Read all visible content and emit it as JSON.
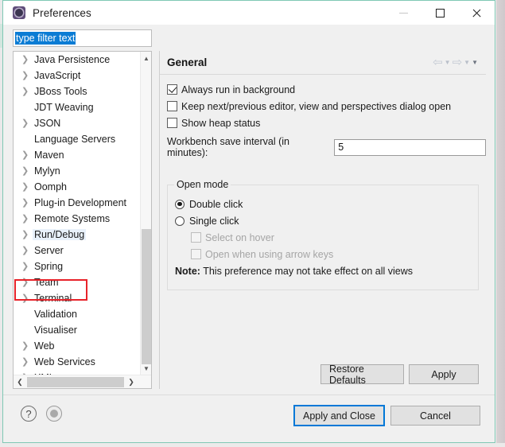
{
  "window": {
    "title": "Preferences",
    "icon": "preferences-gear-icon",
    "controls": {
      "minimize": "minimize-icon",
      "maximize": "maximize-icon",
      "close": "close-icon"
    }
  },
  "filter": {
    "value": "type filter text",
    "placeholder": "type filter text",
    "selected": true
  },
  "tree": {
    "items": [
      {
        "label": "Java Persistence",
        "expandable": true,
        "selected": false
      },
      {
        "label": "JavaScript",
        "expandable": true,
        "selected": false
      },
      {
        "label": "JBoss Tools",
        "expandable": true,
        "selected": false
      },
      {
        "label": "JDT Weaving",
        "expandable": false,
        "selected": false
      },
      {
        "label": "JSON",
        "expandable": true,
        "selected": false
      },
      {
        "label": "Language Servers",
        "expandable": false,
        "selected": false
      },
      {
        "label": "Maven",
        "expandable": true,
        "selected": false
      },
      {
        "label": "Mylyn",
        "expandable": true,
        "selected": false
      },
      {
        "label": "Oomph",
        "expandable": true,
        "selected": false
      },
      {
        "label": "Plug-in Development",
        "expandable": true,
        "selected": false
      },
      {
        "label": "Remote Systems",
        "expandable": true,
        "selected": false
      },
      {
        "label": "Run/Debug",
        "expandable": true,
        "selected": true
      },
      {
        "label": "Server",
        "expandable": true,
        "selected": false
      },
      {
        "label": "Spring",
        "expandable": true,
        "selected": false,
        "annotated": true
      },
      {
        "label": "Team",
        "expandable": true,
        "selected": false
      },
      {
        "label": "Terminal",
        "expandable": true,
        "selected": false
      },
      {
        "label": "Validation",
        "expandable": false,
        "selected": false
      },
      {
        "label": "Visualiser",
        "expandable": false,
        "selected": false
      },
      {
        "label": "Web",
        "expandable": true,
        "selected": false
      },
      {
        "label": "Web Services",
        "expandable": true,
        "selected": false
      },
      {
        "label": "XML",
        "expandable": true,
        "selected": false
      }
    ],
    "annotation_color": "#e8232a"
  },
  "content": {
    "title": "General",
    "nav": {
      "back": "back-arrow-icon",
      "back_menu": "chevron-down-icon",
      "forward": "forward-arrow-icon",
      "forward_menu": "chevron-down-icon",
      "view_menu": "chevron-down-icon"
    },
    "checkboxes": [
      {
        "label": "Always run in background",
        "checked": true,
        "enabled": true
      },
      {
        "label": "Keep next/previous editor, view and perspectives dialog open",
        "checked": false,
        "enabled": true
      },
      {
        "label": "Show heap status",
        "checked": false,
        "enabled": true
      }
    ],
    "interval": {
      "label": "Workbench save interval (in minutes):",
      "value": "5"
    },
    "open_mode": {
      "legend": "Open mode",
      "radios": [
        {
          "label": "Double click",
          "selected": true
        },
        {
          "label": "Single click",
          "selected": false
        }
      ],
      "sub_checkboxes": [
        {
          "label": "Select on hover",
          "checked": false,
          "enabled": false
        },
        {
          "label": "Open when using arrow keys",
          "checked": false,
          "enabled": false
        }
      ],
      "note_prefix": "Note:",
      "note_text": "This preference may not take effect on all views"
    },
    "buttons": {
      "restore_defaults": "Restore Defaults",
      "apply": "Apply"
    }
  },
  "footer": {
    "help_icon": "help-icon",
    "record_icon": "record-icon",
    "apply_and_close": "Apply and Close",
    "cancel": "Cancel",
    "focus_color": "#0078d7"
  }
}
